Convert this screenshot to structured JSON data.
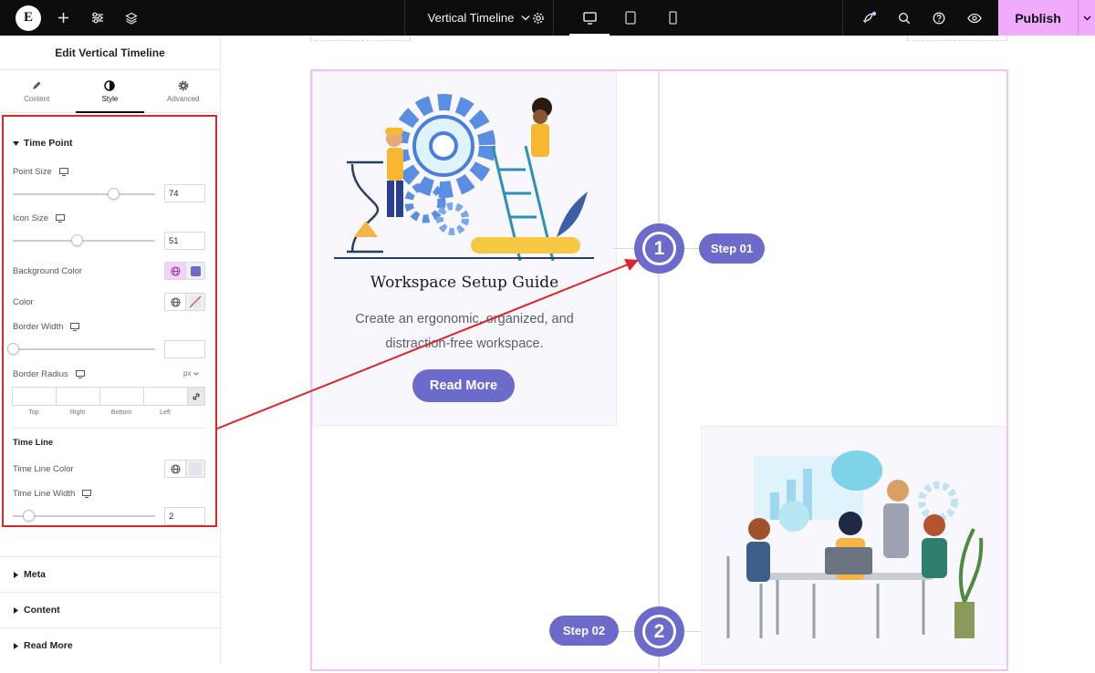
{
  "topbar": {
    "doc_title": "Vertical Timeline",
    "publish_label": "Publish",
    "icons": [
      "elementor-logo-icon",
      "plus-icon",
      "sliders-icon",
      "layers-icon",
      "chevron-down-icon",
      "gear-icon",
      "desktop-icon",
      "tablet-icon",
      "mobile-icon",
      "rocket-icon",
      "search-icon",
      "help-icon",
      "eye-icon"
    ],
    "logo_letter": "E",
    "publish_color": "#f0abfc"
  },
  "panel": {
    "header": "Edit Vertical Timeline",
    "tabs": [
      {
        "label": "Content",
        "icon": "pencil-icon"
      },
      {
        "label": "Style",
        "icon": "half-circle-icon"
      },
      {
        "label": "Advanced",
        "icon": "gear-icon"
      }
    ],
    "section": {
      "title": "Time Point",
      "point_size": {
        "label": "Point Size",
        "value": "74",
        "fraction": 0.71
      },
      "icon_size": {
        "label": "Icon Size",
        "value": "51",
        "fraction": 0.46
      },
      "background_color": {
        "label": "Background Color",
        "swatch": "#6c6bc9"
      },
      "color": {
        "label": "Color"
      },
      "border_width": {
        "label": "Border Width",
        "value": "",
        "fraction": 0
      },
      "border_radius": {
        "label": "Border Radius",
        "unit": "px",
        "sides": [
          "Top",
          "Right",
          "Bottom",
          "Left"
        ]
      },
      "time_line": {
        "title": "Time Line",
        "color_label": "Time Line Color",
        "color_swatch": "#e3e4ee",
        "width_label": "Time Line Width",
        "width_value": "2",
        "fraction": 0.11
      }
    },
    "collapsed": [
      "Meta",
      "Content",
      "Read More"
    ]
  },
  "canvas": {
    "card1": {
      "title": "Workspace Setup Guide",
      "desc_line1": "Create an ergonomic, organized, and",
      "desc_line2": "distraction-free workspace.",
      "button": "Read More"
    },
    "points": [
      {
        "number": "1",
        "label": "Step 01"
      },
      {
        "number": "2",
        "label": "Step 02"
      }
    ],
    "accent": "#6c6bc9",
    "annotation_color": "#d9252b"
  }
}
